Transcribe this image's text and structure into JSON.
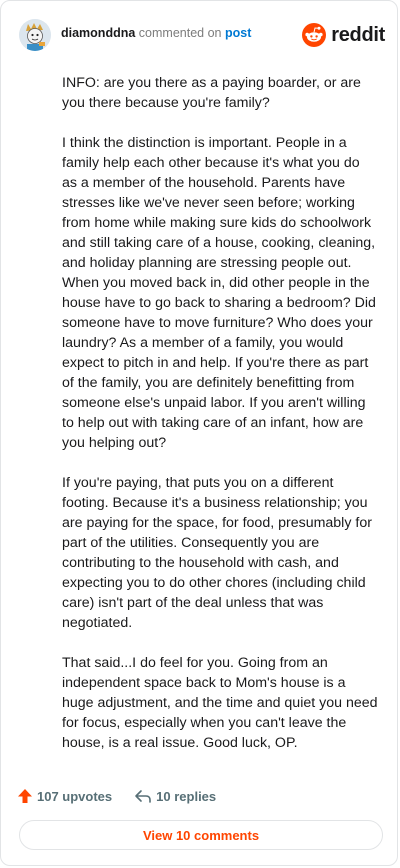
{
  "comment": {
    "username": "diamonddna",
    "action_text": "commented on",
    "post_link": "post",
    "paragraphs": [
      "INFO: are you there as a paying boarder, or are you there because you're family?",
      "I think the distinction is important. People in a family help each other because it's what you do as a member of the household. Parents have stresses like we've never seen before; working from home while making sure kids do schoolwork and still taking care of a house, cooking, cleaning, and holiday planning are stressing people out. When you moved back in, did other people in the house have to go back to sharing a bedroom? Did someone have to move furniture? Who does your laundry? As a member of a family, you would expect to pitch in and help. If you're there as part of the family, you are definitely benefitting from someone else's unpaid labor. If you aren't willing to help out with taking care of an infant, how are you helping out?",
      "If you're paying, that puts you on a different footing. Because it's a business relationship; you are paying for the space, for food, presumably for part of the utilities. Consequently you are contributing to the household with cash, and expecting you to do other chores (including child care) isn't part of the deal unless that was negotiated.",
      "That said...I do feel for you. Going from an independent space back to Mom's house is a huge adjustment, and the time and quiet you need for focus, especially when you can't leave the house, is a real issue. Good luck, OP."
    ],
    "upvotes_label": "107 upvotes",
    "replies_label": "10 replies",
    "view_comments_label": "View 10 comments"
  },
  "brand": {
    "name": "reddit",
    "icon": "reddit-snoo-icon"
  },
  "colors": {
    "accent": "#ff4500",
    "link": "#0079d3",
    "muted": "#576f76"
  }
}
